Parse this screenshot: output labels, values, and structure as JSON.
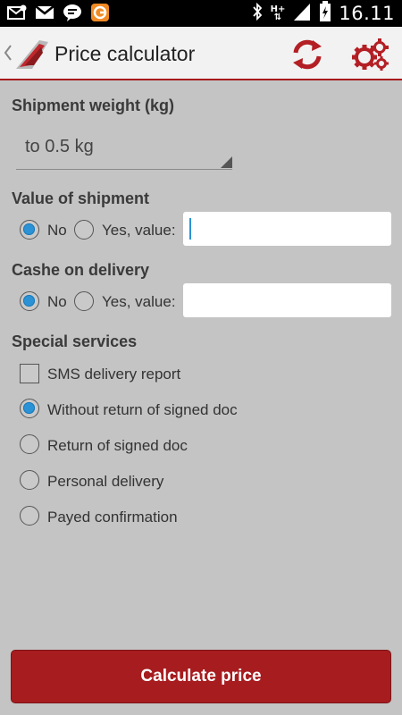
{
  "status_bar": {
    "time": "16.11",
    "network_label": "H+",
    "icons": [
      "missed-email-icon",
      "gmail-icon",
      "chat-icon",
      "app-notification-icon",
      "bluetooth-icon",
      "signal-icon",
      "battery-charging-icon"
    ]
  },
  "header": {
    "title": "Price calculator",
    "accent_color": "#a6191d"
  },
  "weight": {
    "label": "Shipment weight (kg)",
    "selected": "to 0.5 kg"
  },
  "value_section": {
    "label": "Value of shipment",
    "no_label": "No",
    "yes_label": "Yes, value:",
    "selected": "No",
    "input_value": ""
  },
  "cod_section": {
    "label": "Cashe on delivery",
    "no_label": "No",
    "yes_label": "Yes, value:",
    "selected": "No",
    "input_value": ""
  },
  "services": {
    "label": "Special services",
    "sms_label": "SMS delivery report",
    "sms_checked": false,
    "options": [
      {
        "label": "Without return of signed doc",
        "selected": true
      },
      {
        "label": "Return of signed doc",
        "selected": false
      },
      {
        "label": "Personal delivery",
        "selected": false
      },
      {
        "label": "Payed confirmation",
        "selected": false
      }
    ]
  },
  "calculate_label": "Calculate price"
}
